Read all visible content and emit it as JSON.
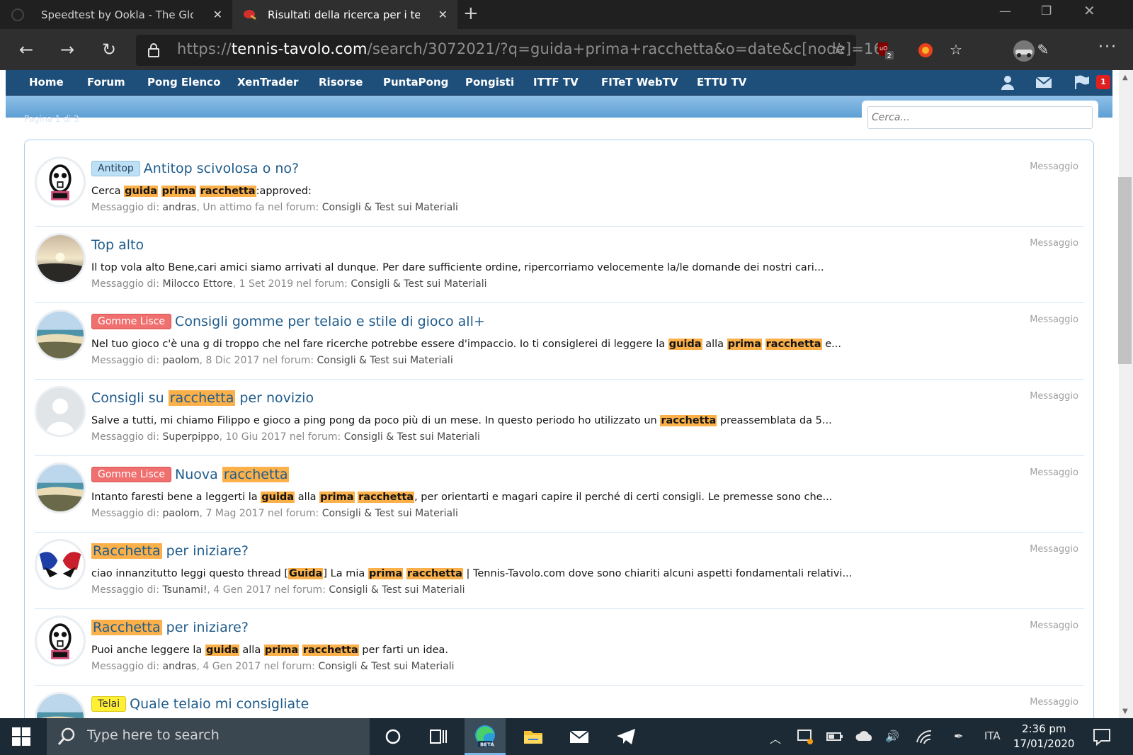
{
  "browser": {
    "tabs": [
      {
        "title": "Speedtest by Ookla - The Global Broadband Speed Test",
        "active": false
      },
      {
        "title": "Risultati della ricerca per i termini",
        "active": true
      }
    ],
    "url_scheme": "https://",
    "url_host": "tennis-tavolo.com",
    "url_path": "/search/3072021/?q=guida+prima+racchetta&o=date&c[node]=16",
    "extension_badge": "2",
    "icons": {
      "back": "back-arrow-icon",
      "forward": "forward-arrow-icon",
      "reload": "reload-icon",
      "lock": "lock-icon",
      "favorite": "star-icon"
    }
  },
  "site": {
    "nav_items": [
      "Home",
      "Forum",
      "Pong Elenco",
      "XenTrader",
      "Risorse",
      "PuntaPong",
      "Pongisti",
      "ITTF TV",
      "FITeT WebTV",
      "ETTU TV"
    ],
    "alerts_count": "1",
    "search_placeholder": "Cerca...",
    "pager_ghost": "Pagina 1 di 3",
    "accent_color": "#1d4f7a",
    "highlight_color": "#fbb04a"
  },
  "results": [
    {
      "prefix": "Antitop",
      "prefix_style": "antitop",
      "title": [
        {
          "t": "Antitop scivolosa o no?"
        }
      ],
      "snippet": [
        {
          "t": "Cerca "
        },
        {
          "t": "guida",
          "hl": true
        },
        {
          "t": " "
        },
        {
          "t": "prima",
          "hl": true
        },
        {
          "t": " "
        },
        {
          "t": "racchetta",
          "hl": true
        },
        {
          "t": ":approved:"
        }
      ],
      "meta_label": "Messaggio di:",
      "author": "andras",
      "date": "Un attimo fa",
      "forum_label": "nel forum:",
      "forum": "Consigli & Test sui Materiali",
      "type": "Messaggio",
      "avatar": "robot"
    },
    {
      "prefix": "",
      "prefix_style": "",
      "title": [
        {
          "t": "Top alto"
        }
      ],
      "snippet": [
        {
          "t": "Il top vola alto Bene,cari amici siamo arrivati al dunque. Per dare sufficiente ordine, ripercorriamo velocemente la/le domande dei nostri cari..."
        }
      ],
      "meta_label": "Messaggio di:",
      "author": "Milocco Ettore",
      "date": "1 Set 2019",
      "forum_label": "nel forum:",
      "forum": "Consigli & Test sui Materiali",
      "type": "Messaggio",
      "avatar": "sunset"
    },
    {
      "prefix": "Gomme Lisce",
      "prefix_style": "lisce",
      "title": [
        {
          "t": "Consigli gomme per telaio e stile di gioco all+"
        }
      ],
      "snippet": [
        {
          "t": "Nel tuo gioco c'è una g di troppo che nel fare ricerche potrebbe essere d'impaccio. Io ti consiglerei di leggere la "
        },
        {
          "t": "guida",
          "hl": true
        },
        {
          "t": " alla "
        },
        {
          "t": "prima",
          "hl": true
        },
        {
          "t": " "
        },
        {
          "t": "racchetta",
          "hl": true
        },
        {
          "t": " e..."
        }
      ],
      "meta_label": "Messaggio di:",
      "author": "paolom",
      "date": "8 Dic 2017",
      "forum_label": "nel forum:",
      "forum": "Consigli & Test sui Materiali",
      "type": "Messaggio",
      "avatar": "beach"
    },
    {
      "prefix": "",
      "prefix_style": "",
      "title": [
        {
          "t": "Consigli su "
        },
        {
          "t": "racchetta",
          "hl": true
        },
        {
          "t": " per novizio"
        }
      ],
      "snippet": [
        {
          "t": "Salve a tutti, mi chiamo Filippo e gioco a ping pong da poco più di un mese. In questo periodo ho utilizzato un "
        },
        {
          "t": "racchetta",
          "hl": true
        },
        {
          "t": " preassemblata da 5..."
        }
      ],
      "meta_label": "Messaggio di:",
      "author": "Superpippo",
      "date": "10 Giu 2017",
      "forum_label": "nel forum:",
      "forum": "Consigli & Test sui Materiali",
      "type": "Messaggio",
      "avatar": "default"
    },
    {
      "prefix": "Gomme Lisce",
      "prefix_style": "lisce",
      "title": [
        {
          "t": "Nuova "
        },
        {
          "t": "racchetta",
          "hl": true
        }
      ],
      "snippet": [
        {
          "t": "Intanto faresti bene a leggerti la "
        },
        {
          "t": "guida",
          "hl": true
        },
        {
          "t": " alla "
        },
        {
          "t": "prima",
          "hl": true
        },
        {
          "t": " "
        },
        {
          "t": "racchetta",
          "hl": true
        },
        {
          "t": ", per orientarti e magari capire il perché di certi consigli. Le premesse sono che..."
        }
      ],
      "meta_label": "Messaggio di:",
      "author": "paolom",
      "date": "7 Mag 2017",
      "forum_label": "nel forum:",
      "forum": "Consigli & Test sui Materiali",
      "type": "Messaggio",
      "avatar": "beach"
    },
    {
      "prefix": "",
      "prefix_style": "",
      "title": [
        {
          "t": "Racchetta",
          "hl": true
        },
        {
          "t": " per iniziare?"
        }
      ],
      "snippet": [
        {
          "t": "ciao innanzitutto leggi questo thread ["
        },
        {
          "t": "Guida",
          "hl": true
        },
        {
          "t": "] La mia "
        },
        {
          "t": "prima",
          "hl": true
        },
        {
          "t": " "
        },
        {
          "t": "racchetta",
          "hl": true
        },
        {
          "t": " | Tennis-Tavolo.com dove sono chiariti alcuni aspetti fondamentali relativi..."
        }
      ],
      "meta_label": "Messaggio di:",
      "author": "Tsunami!",
      "date": "4 Gen 2017",
      "forum_label": "nel forum:",
      "forum": "Consigli & Test sui Materiali",
      "type": "Messaggio",
      "avatar": "tsunami"
    },
    {
      "prefix": "",
      "prefix_style": "",
      "title": [
        {
          "t": "Racchetta",
          "hl": true
        },
        {
          "t": " per iniziare?"
        }
      ],
      "snippet": [
        {
          "t": "Puoi anche leggere la "
        },
        {
          "t": "guida",
          "hl": true
        },
        {
          "t": " alla "
        },
        {
          "t": "prima",
          "hl": true
        },
        {
          "t": " "
        },
        {
          "t": "racchetta",
          "hl": true
        },
        {
          "t": " per farti un idea."
        }
      ],
      "meta_label": "Messaggio di:",
      "author": "andras",
      "date": "4 Gen 2017",
      "forum_label": "nel forum:",
      "forum": "Consigli & Test sui Materiali",
      "type": "Messaggio",
      "avatar": "robot"
    },
    {
      "prefix": "Telai",
      "prefix_style": "telai",
      "title": [
        {
          "t": "Quale telaio mi consigliate"
        }
      ],
      "snippet": [],
      "meta_label": "",
      "author": "",
      "date": "",
      "forum_label": "",
      "forum": "",
      "type": "Messaggio",
      "avatar": "beach"
    }
  ],
  "taskbar": {
    "search_placeholder": "Type here to search",
    "language": "ITA",
    "time": "2:36 pm",
    "date": "17/01/2020",
    "edge_label": "BETA"
  }
}
